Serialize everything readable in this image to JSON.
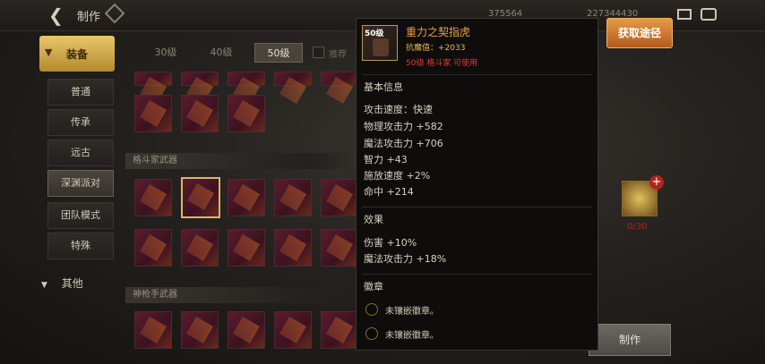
{
  "header": {
    "back_icon": "back-arrow-icon",
    "title": "制作",
    "currency_1": "375564",
    "currency_2": "227344430"
  },
  "sidebar": {
    "main_category": "装备",
    "items": [
      "普通",
      "传承",
      "远古",
      "深渊派对",
      "团队模式",
      "特殊"
    ],
    "active_index": 3,
    "other_label": "其他"
  },
  "level_tabs": {
    "tabs": [
      "30级",
      "40级",
      "50级"
    ],
    "active_index": 2,
    "checkbox_label": "推荐"
  },
  "sections": {
    "fighter": "格斗家武器",
    "gunner": "神枪手武器"
  },
  "buttons": {
    "obtain": "获取途径",
    "make": "制作"
  },
  "material": {
    "count": "0/30"
  },
  "tooltip": {
    "level_badge": "50级",
    "name": "重力之契指虎",
    "score": "抗魔值：+2033",
    "requirement": "50级 格斗家 可使用",
    "basic_header": "基本信息",
    "stats": [
      "攻击速度：快速",
      "物理攻击力 +582",
      "魔法攻击力 +706",
      "智力 +43",
      "施放速度 +2%",
      "命中 +214"
    ],
    "effect_header": "效果",
    "effects": [
      "伤害 +10%",
      "魔法攻击力 +18%"
    ],
    "emblem_header": "徽章",
    "emblems": [
      "未镶嵌徽章。",
      "未镶嵌徽章。"
    ]
  },
  "colors": {
    "item_name": "#e6a050",
    "requirement": "#e23a2a",
    "accent_gold": "#e9c66a",
    "obtain_button": "#d07a30"
  }
}
